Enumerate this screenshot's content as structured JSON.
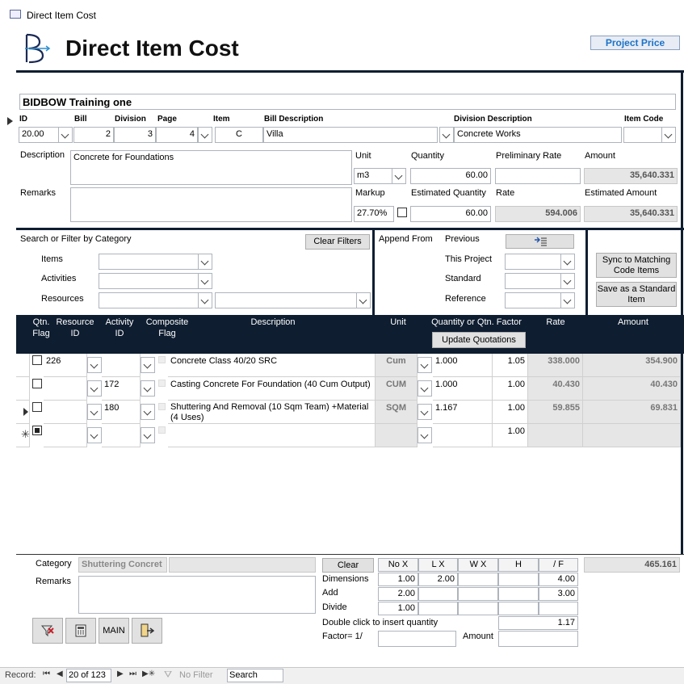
{
  "window": {
    "title": "Direct Item Cost"
  },
  "header": {
    "title": "Direct Item Cost",
    "project_price": "Project Price"
  },
  "project": {
    "name": "BIDBOW Training one"
  },
  "fields": {
    "id_label": "ID",
    "bill_label": "Bill",
    "division_label": "Division",
    "page_label": "Page",
    "item_label": "Item",
    "bill_desc_label": "Bill Description",
    "div_desc_label": "Division Description",
    "item_code_label": "Item Code",
    "id": "20.00",
    "bill": "2",
    "division": "3",
    "page": "4",
    "item": "C",
    "bill_desc": "Villa",
    "div_desc": "Concrete Works",
    "item_code": "",
    "description_label": "Description",
    "description": "Concrete for Foundations",
    "remarks_label": "Remarks",
    "remarks": "",
    "unit_label": "Unit",
    "unit": "m3",
    "quantity_label": "Quantity",
    "quantity": "60.00",
    "prelim_rate_label": "Preliminary Rate",
    "prelim_rate": "",
    "amount_label": "Amount",
    "amount": "35,640.331",
    "markup_label": "Markup",
    "markup": "27.70%",
    "est_qty_label": "Estimated Quantity",
    "est_qty": "60.00",
    "rate_label": "Rate",
    "rate": "594.006",
    "est_amount_label": "Estimated Amount",
    "est_amount": "35,640.331"
  },
  "filter": {
    "title": "Search or Filter by Category",
    "clear": "Clear Filters",
    "items": "Items",
    "activities": "Activities",
    "resources": "Resources"
  },
  "append": {
    "title": "Append From",
    "previous": "Previous",
    "this_project": "This Project",
    "standard": "Standard",
    "reference": "Reference"
  },
  "actions": {
    "sync": "Sync to Matching Code Items",
    "save_std": "Save as a Standard Item"
  },
  "grid": {
    "headers": {
      "qtn_flag": "Qtn. Flag",
      "resource_id": "Resource ID",
      "activity_id": "Activity ID",
      "composite_flag": "Composite Flag",
      "description": "Description",
      "unit": "Unit",
      "qty_factor": "Quantity or Qtn. Factor",
      "rate": "Rate",
      "amount": "Amount",
      "update": "Update Quotations"
    },
    "rows": [
      {
        "resource": "226",
        "activity": "",
        "description": "Concrete Class 40/20 SRC",
        "unit": "Cum",
        "qty": "1.000",
        "factor": "1.05",
        "rate": "338.000",
        "amount": "354.900"
      },
      {
        "resource": "",
        "activity": "172",
        "description": "Casting Concrete For Foundation (40 Cum Output)",
        "unit": "CUM",
        "qty": "1.000",
        "factor": "1.00",
        "rate": "40.430",
        "amount": "40.430"
      },
      {
        "resource": "",
        "activity": "180",
        "description": "Shuttering And Removal (10 Sqm Team) +Material (4 Uses)",
        "unit": "SQM",
        "qty": "1.167",
        "factor": "1.00",
        "rate": "59.855",
        "amount": "69.831"
      }
    ],
    "new_row_factor": "1.00"
  },
  "bottom": {
    "category_label": "Category",
    "category": "Shuttering Concret",
    "remarks_label": "Remarks",
    "clear": "Clear",
    "col_nox": "No X",
    "col_lx": "L X",
    "col_wx": "W X",
    "col_h": "H",
    "col_f": "/ F",
    "dimensions": "Dimensions",
    "add": "Add",
    "divide": "Divide",
    "dim_nox": "1.00",
    "dim_lx": "2.00",
    "dim_f": "4.00",
    "add_nox": "2.00",
    "add_f": "3.00",
    "div_nox": "1.00",
    "total": "465.161",
    "dbl_click": "Double click to insert quantity",
    "dbl_value": "1.17",
    "factor_label": "Factor= 1/",
    "amount_label": "Amount",
    "main": "MAIN"
  },
  "status": {
    "record_label": "Record:",
    "record": "20 of 123",
    "no_filter": "No Filter",
    "search": "Search"
  }
}
